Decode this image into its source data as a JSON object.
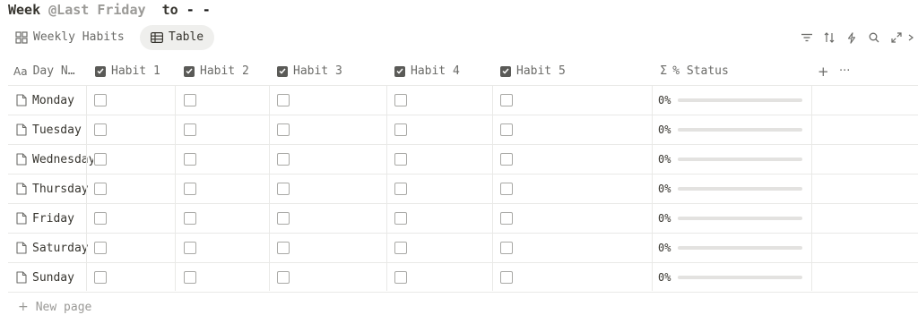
{
  "title": {
    "week_label": "Week",
    "mention": "@Last Friday",
    "to_label": "to",
    "range_end": "- -"
  },
  "views": {
    "weekly_habits": "Weekly Habits",
    "table": "Table"
  },
  "columns": {
    "name": "Day N…",
    "habits": [
      "Habit 1",
      "Habit 2",
      "Habit 3",
      "Habit 4",
      "Habit 5"
    ],
    "status": "% Status"
  },
  "rows": [
    {
      "name": "Monday",
      "status": "0%",
      "progress": 0
    },
    {
      "name": "Tuesday",
      "status": "0%",
      "progress": 0
    },
    {
      "name": "Wednesday",
      "status": "0%",
      "progress": 0
    },
    {
      "name": "Thursday",
      "status": "0%",
      "progress": 0
    },
    {
      "name": "Friday",
      "status": "0%",
      "progress": 0
    },
    {
      "name": "Saturday",
      "status": "0%",
      "progress": 0
    },
    {
      "name": "Sunday",
      "status": "0%",
      "progress": 0
    }
  ],
  "new_page_label": "New page",
  "icons": [
    "filter-icon",
    "sort-icon",
    "automation-icon",
    "search-icon",
    "expand-icon",
    "more-icon"
  ],
  "colors": {
    "text": "#37352f",
    "muted": "#9b9a97",
    "border": "#e9e9e7",
    "active_tab_bg": "#efefed"
  }
}
